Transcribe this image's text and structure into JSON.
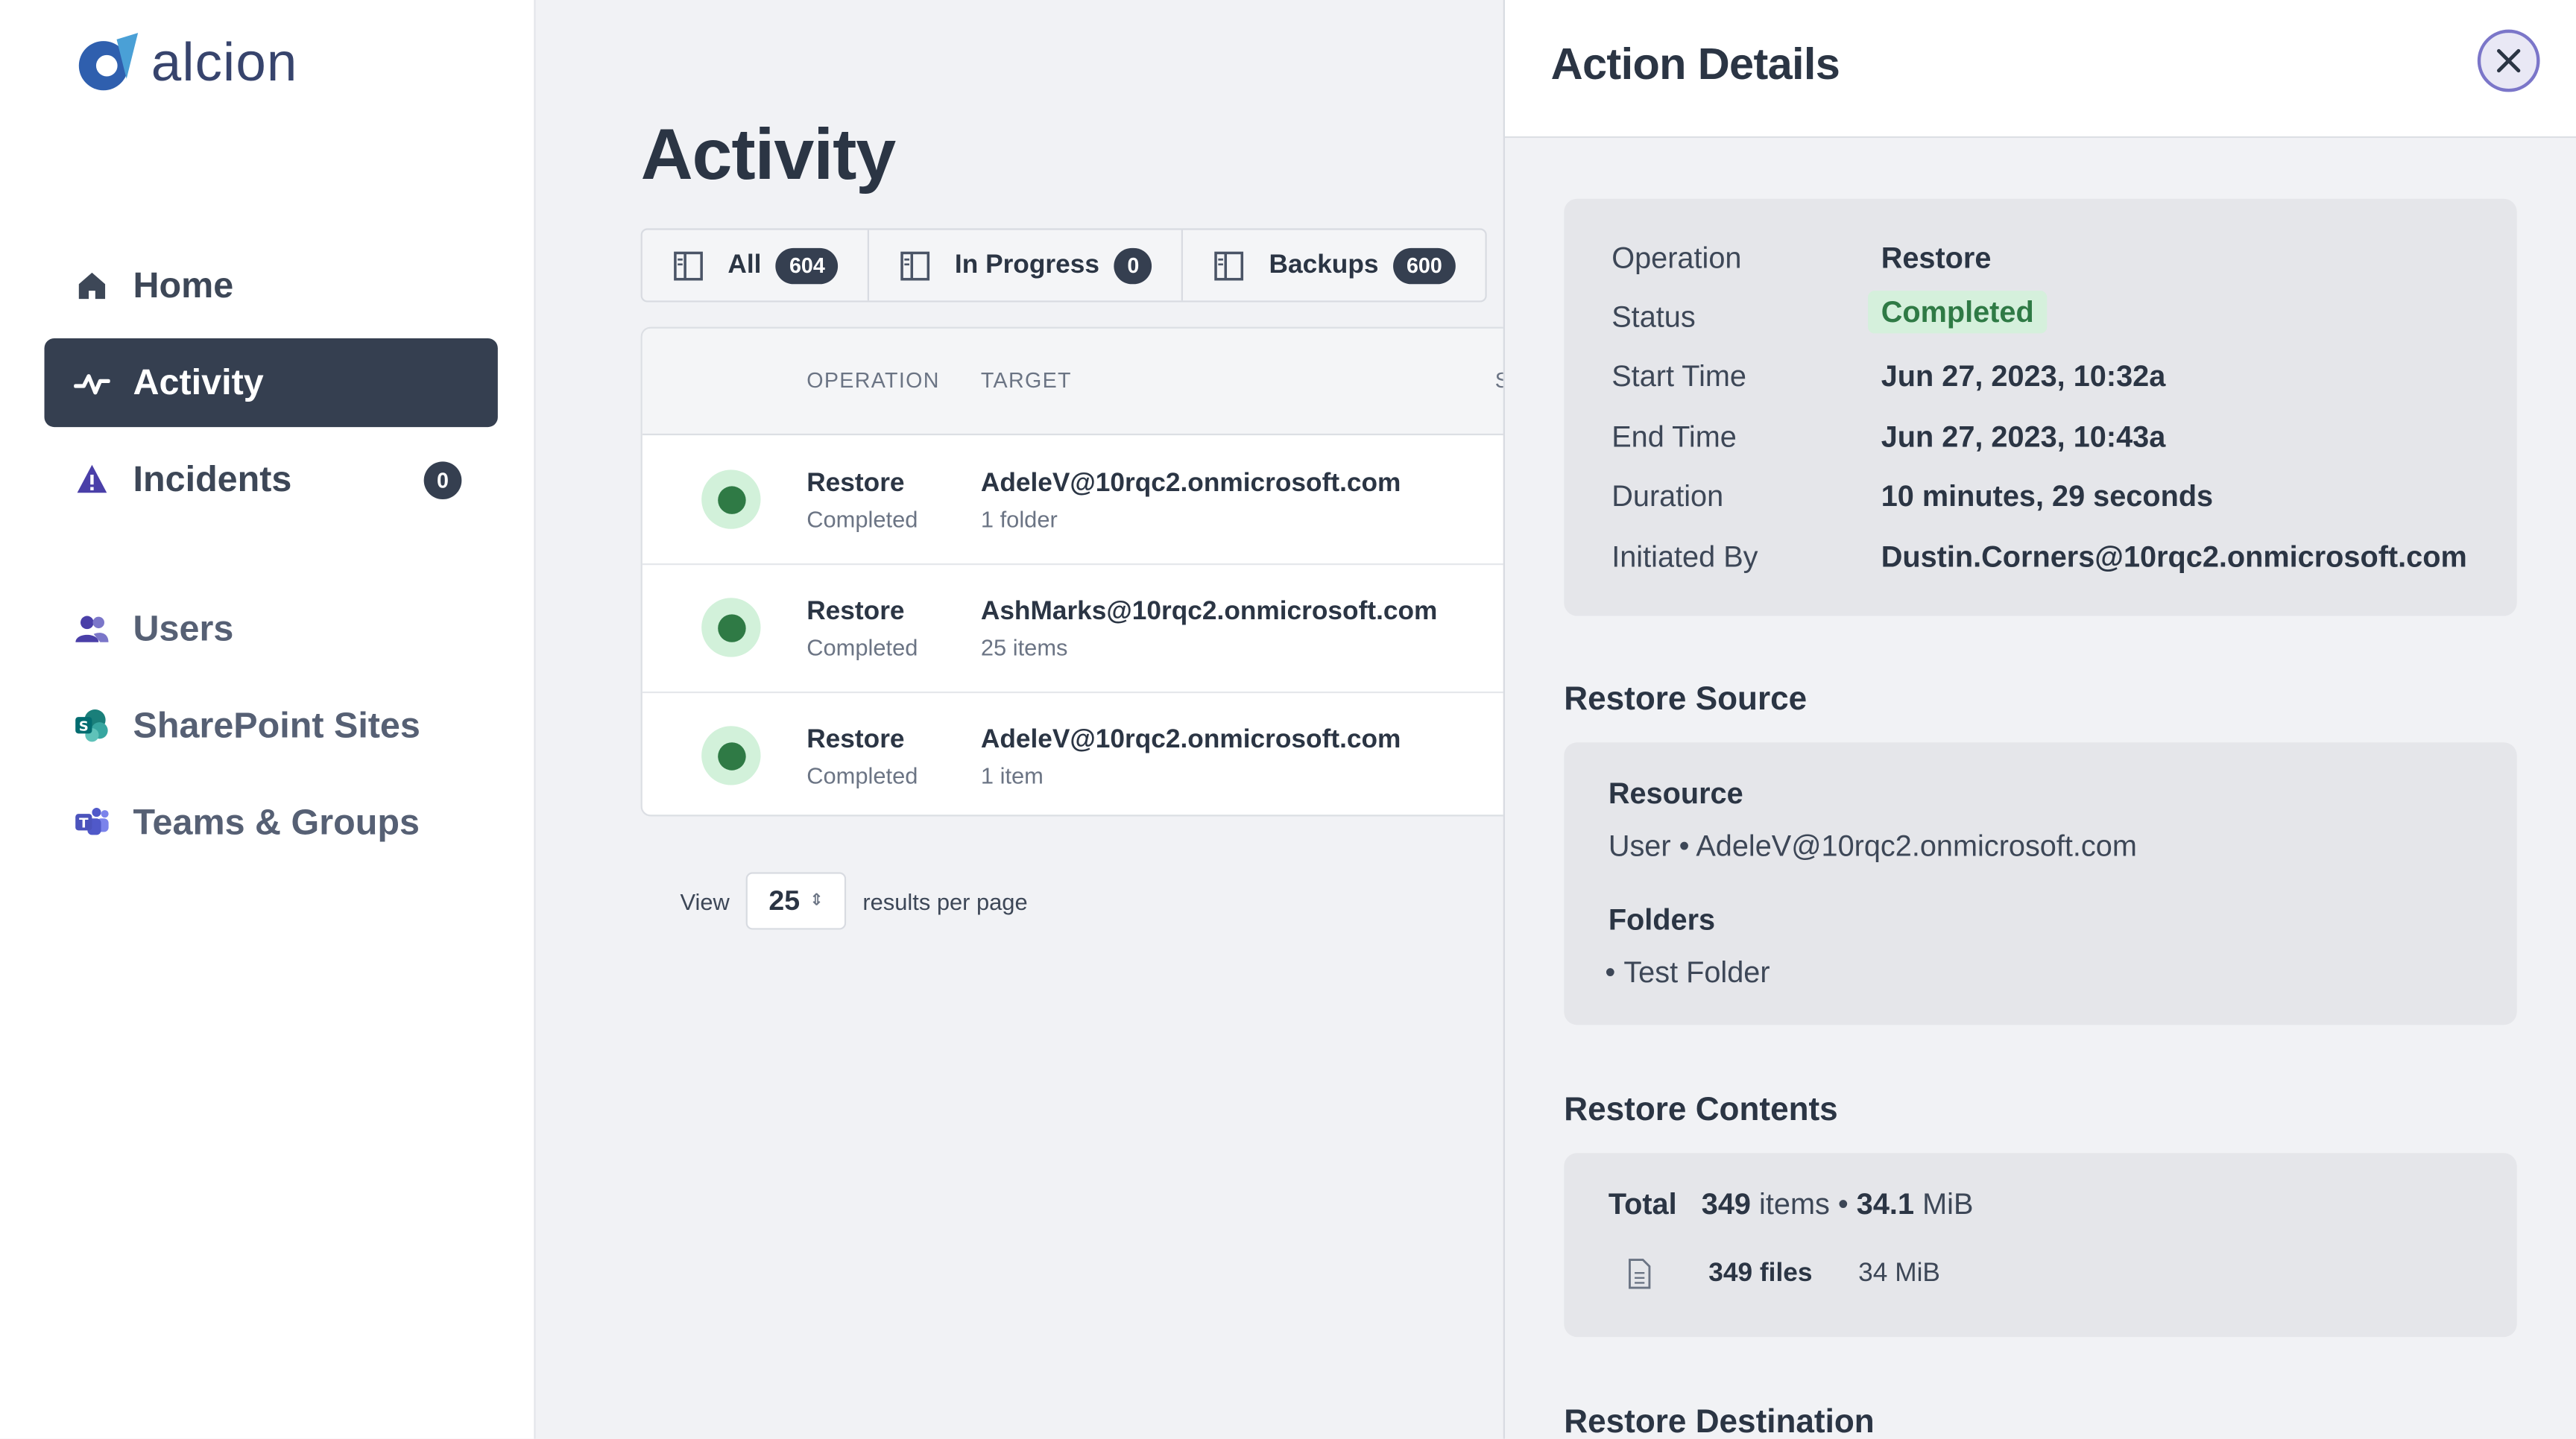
{
  "brand": {
    "name": "alcion"
  },
  "sidebar": {
    "items": [
      {
        "label": "Home"
      },
      {
        "label": "Activity"
      },
      {
        "label": "Incidents",
        "badge": "0"
      },
      {
        "label": "Users"
      },
      {
        "label": "SharePoint Sites"
      },
      {
        "label": "Teams & Groups"
      }
    ]
  },
  "activity": {
    "title": "Activity",
    "tabs": [
      {
        "label": "All",
        "count": "604"
      },
      {
        "label": "In Progress",
        "count": "0"
      },
      {
        "label": "Backups",
        "count": "600"
      }
    ],
    "columns": {
      "operation": "OPERATION",
      "target": "TARGET",
      "cut": "S"
    },
    "rows": [
      {
        "operation": "Restore",
        "status": "Completed",
        "target": "AdeleV@10rqc2.onmicrosoft.com",
        "detail": "1 folder"
      },
      {
        "operation": "Restore",
        "status": "Completed",
        "target": "AshMarks@10rqc2.onmicrosoft.com",
        "detail": "25 items"
      },
      {
        "operation": "Restore",
        "status": "Completed",
        "target": "AdeleV@10rqc2.onmicrosoft.com",
        "detail": "1 item"
      }
    ],
    "pager": {
      "view_label": "View",
      "per_page": "25",
      "suffix": "results per page"
    }
  },
  "drawer": {
    "title": "Action Details",
    "details": [
      {
        "key": "Operation",
        "value": "Restore"
      },
      {
        "key": "Status",
        "value": "Completed"
      },
      {
        "key": "Start Time",
        "value": "Jun 27, 2023, 10:32a"
      },
      {
        "key": "End Time",
        "value": "Jun 27, 2023, 10:43a"
      },
      {
        "key": "Duration",
        "value": "10 minutes, 29 seconds"
      },
      {
        "key": "Initiated By",
        "value": "Dustin.Corners@10rqc2.onmicrosoft.com"
      }
    ],
    "source": {
      "title": "Restore Source",
      "resource_label": "Resource",
      "resource_value": "User • AdeleV@10rqc2.onmicrosoft.com",
      "folders_label": "Folders",
      "folders": [
        "Test Folder"
      ]
    },
    "contents": {
      "title": "Restore Contents",
      "total_label": "Total",
      "items_count": "349",
      "items_word": "items",
      "size_value": "34.1",
      "size_unit": "MiB",
      "files_label": "349 files",
      "files_size": "34 MiB"
    },
    "destination": {
      "title": "Restore Destination"
    }
  },
  "colors": {
    "nav_active_bg": "#353f50",
    "success_green": "#2f7a45",
    "success_bg": "#d5f0dc",
    "accent_purple": "#7b76c9",
    "incident_icon": "#4a3fa8"
  },
  "icons": {
    "home": "home-icon",
    "activity": "pulse-icon",
    "incidents": "warning-triangle-icon",
    "users": "users-icon",
    "sharepoint": "sharepoint-icon",
    "teams": "teams-icon",
    "tab": "sidebar-layout-icon",
    "close": "close-icon",
    "file": "file-icon"
  }
}
